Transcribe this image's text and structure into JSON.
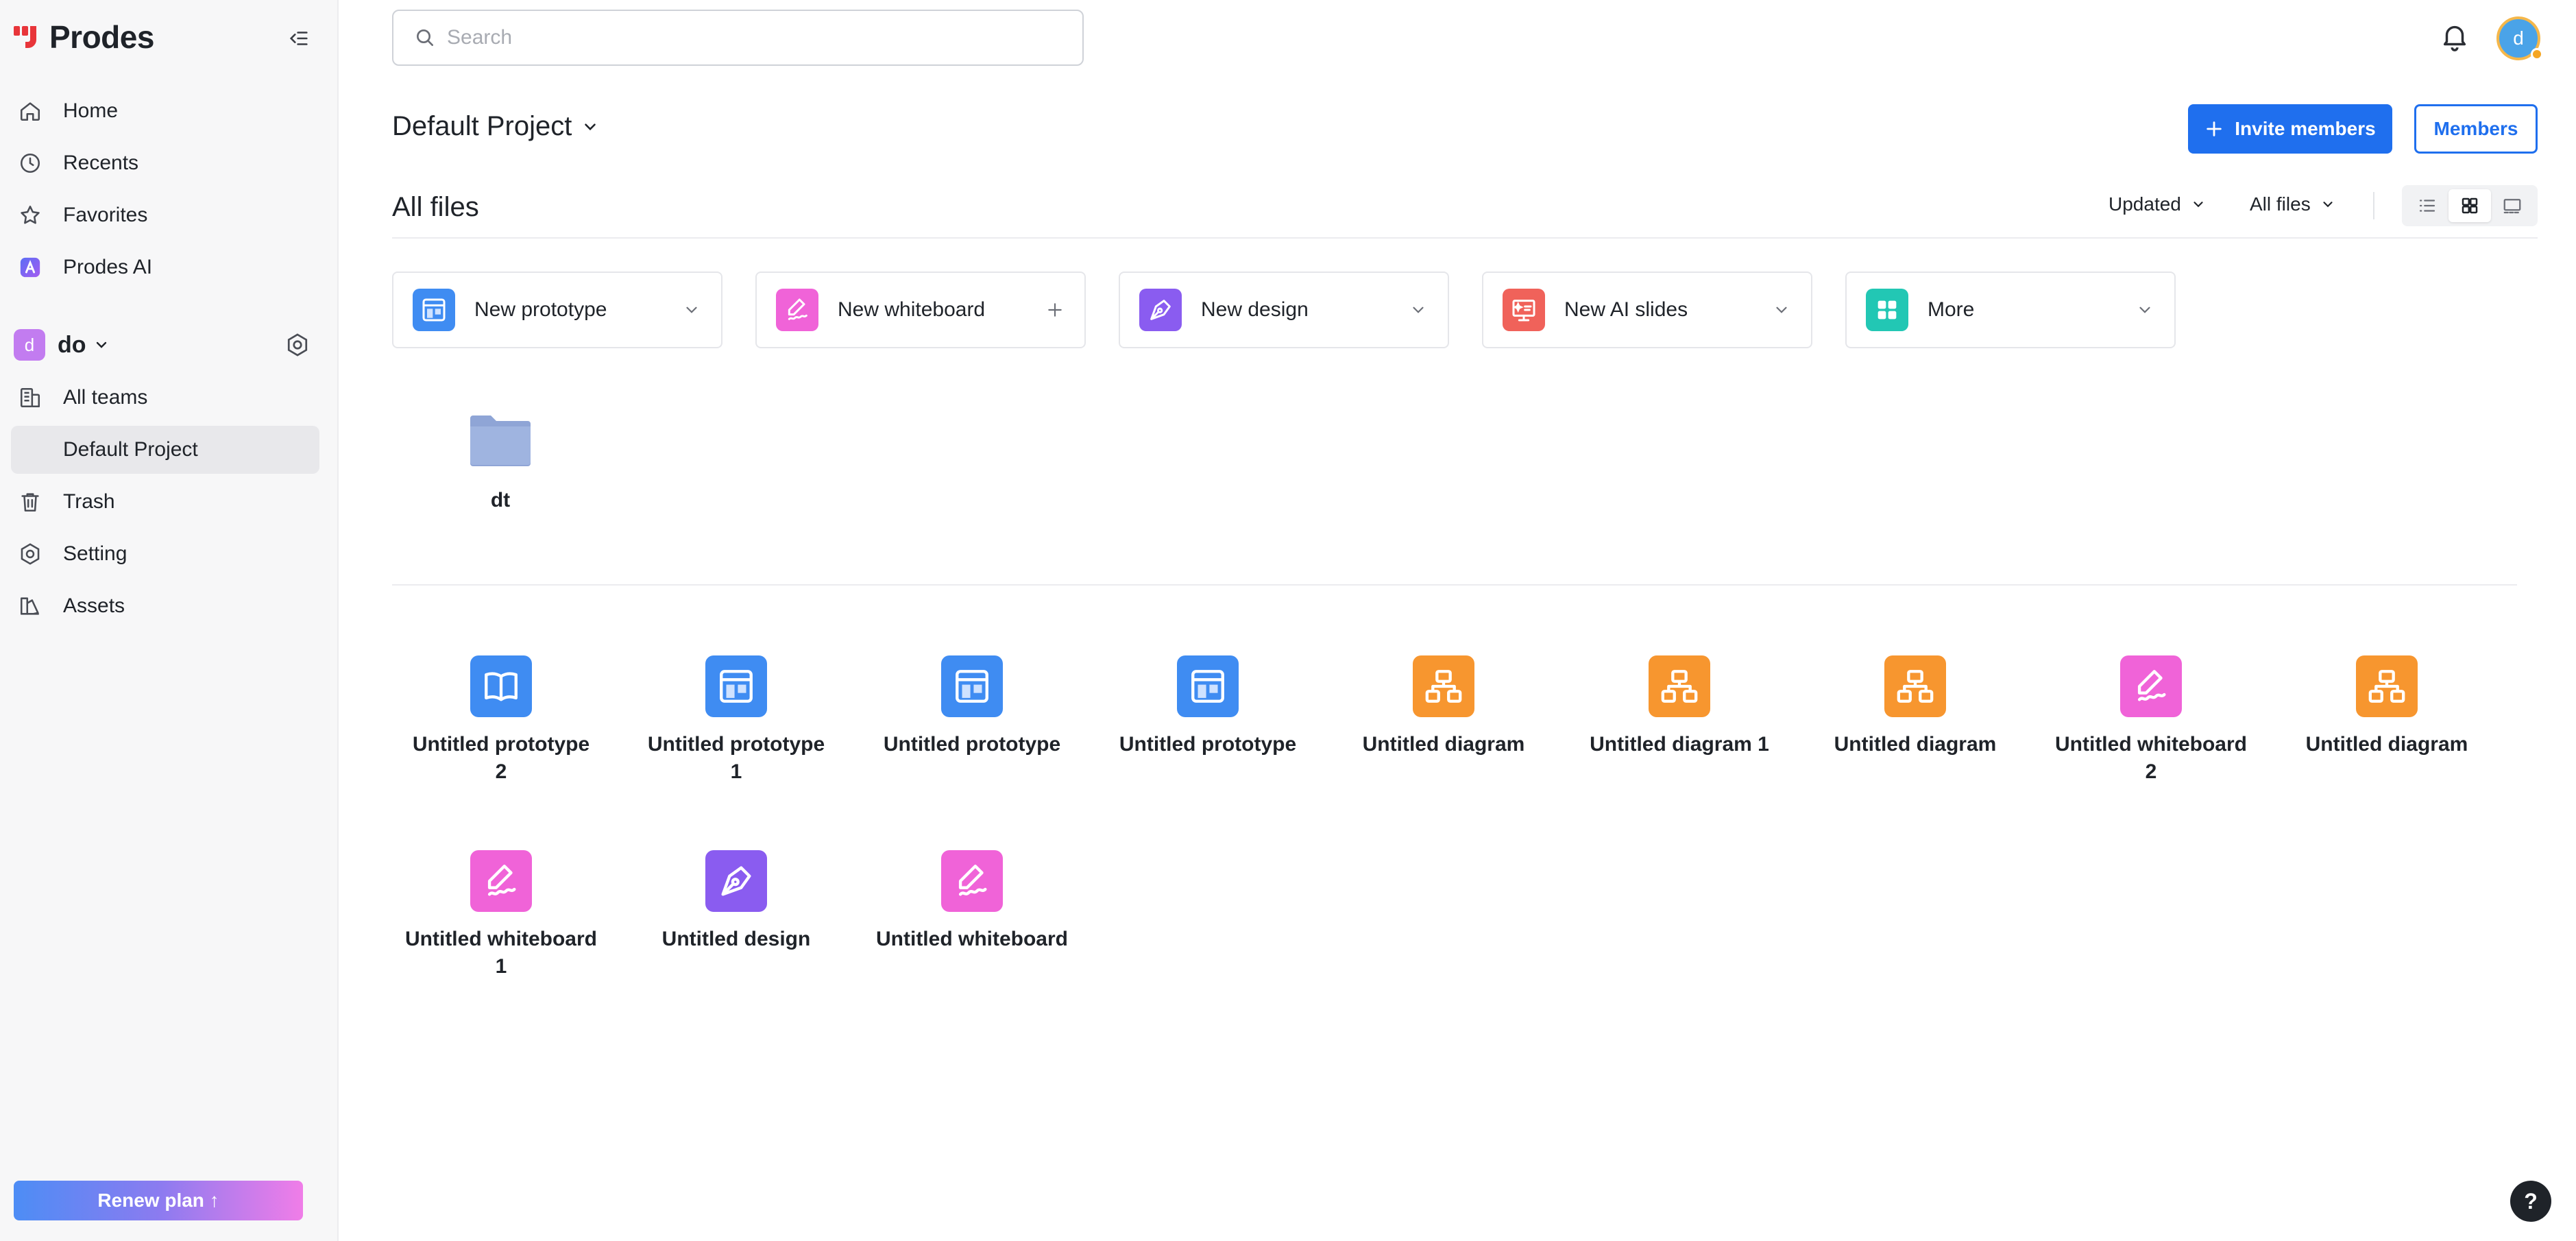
{
  "brand": {
    "name": "Prodes"
  },
  "sidebar": {
    "nav": [
      {
        "label": "Home",
        "icon": "home-icon"
      },
      {
        "label": "Recents",
        "icon": "clock-icon"
      },
      {
        "label": "Favorites",
        "icon": "star-icon"
      },
      {
        "label": "Prodes AI",
        "icon": "ai-icon"
      }
    ],
    "team": {
      "avatar": "d",
      "name": "do"
    },
    "team_nav": [
      {
        "label": "All teams",
        "icon": "teams-icon"
      },
      {
        "label": "Default Project",
        "icon": "",
        "active": true
      },
      {
        "label": "Trash",
        "icon": "trash-icon"
      },
      {
        "label": "Setting",
        "icon": "gear-icon"
      },
      {
        "label": "Assets",
        "icon": "assets-icon"
      }
    ],
    "renew_label": "Renew plan ↑"
  },
  "search": {
    "placeholder": "Search"
  },
  "user": {
    "avatar": "d"
  },
  "project": {
    "title": "Default Project",
    "invite_label": "Invite members",
    "members_label": "Members"
  },
  "files_section": {
    "title": "All files",
    "sort_label": "Updated",
    "filter_label": "All files"
  },
  "create": [
    {
      "label": "New prototype",
      "icon": "prototype-icon",
      "action": "chevron"
    },
    {
      "label": "New whiteboard",
      "icon": "whiteboard-icon",
      "action": "plus"
    },
    {
      "label": "New design",
      "icon": "design-icon",
      "action": "chevron"
    },
    {
      "label": "New AI slides",
      "icon": "slides-icon",
      "action": "chevron"
    },
    {
      "label": "More",
      "icon": "grid-icon",
      "action": "chevron"
    }
  ],
  "folder": {
    "name": "dt"
  },
  "files": [
    {
      "name": "Untitled prototype 2",
      "type": "prototype"
    },
    {
      "name": "Untitled prototype 1",
      "type": "prototype"
    },
    {
      "name": "Untitled prototype",
      "type": "prototype"
    },
    {
      "name": "Untitled prototype",
      "type": "prototype"
    },
    {
      "name": "Untitled diagram",
      "type": "diagram"
    },
    {
      "name": "Untitled diagram 1",
      "type": "diagram"
    },
    {
      "name": "Untitled diagram",
      "type": "diagram"
    },
    {
      "name": "Untitled whiteboard 2",
      "type": "whiteboard"
    },
    {
      "name": "Untitled diagram",
      "type": "diagram"
    },
    {
      "name": "Untitled whiteboard 1",
      "type": "whiteboard"
    },
    {
      "name": "Untitled design",
      "type": "design"
    },
    {
      "name": "Untitled whiteboard",
      "type": "whiteboard"
    }
  ],
  "colors": {
    "accent": "#1f6fee",
    "prototype": "#3f8cf2",
    "diagram": "#f7962f",
    "whiteboard": "#f063d8",
    "design": "#8a5cf0",
    "slides": "#f0625a",
    "more": "#22c7b4"
  },
  "help_label": "?"
}
